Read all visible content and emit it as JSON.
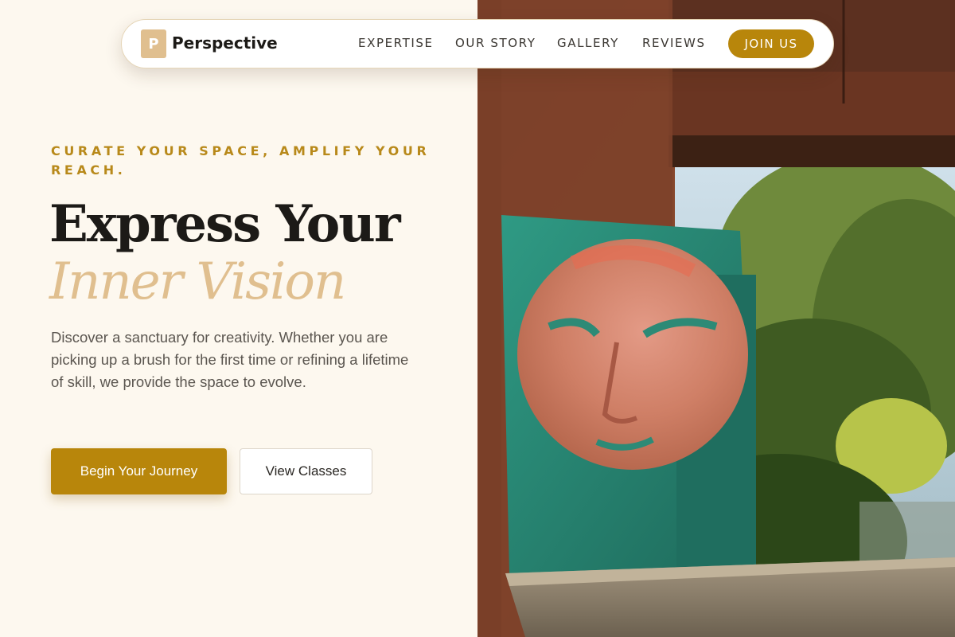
{
  "brand": {
    "logo_letter": "P",
    "name": "Perspective",
    "accent": "#b8860b",
    "light_accent": "#e0bf8f"
  },
  "nav": {
    "links": [
      "EXPERTISE",
      "OUR STORY",
      "GALLERY",
      "REVIEWS"
    ],
    "cta": "JOIN US"
  },
  "hero": {
    "eyebrow": "CURATE YOUR SPACE, AMPLIFY YOUR REACH.",
    "headline_line1": "Express Your",
    "headline_line2": "Inner Vision",
    "description": "Discover a sanctuary for creativity. Whether you are picking up a brush for the first time or refining a lifetime of skill, we provide the space to evolve.",
    "primary_button": "Begin Your Journey",
    "secondary_button": "View Classes"
  },
  "image": {
    "subject": "painted-face-mural-in-rusty-window-frame"
  }
}
